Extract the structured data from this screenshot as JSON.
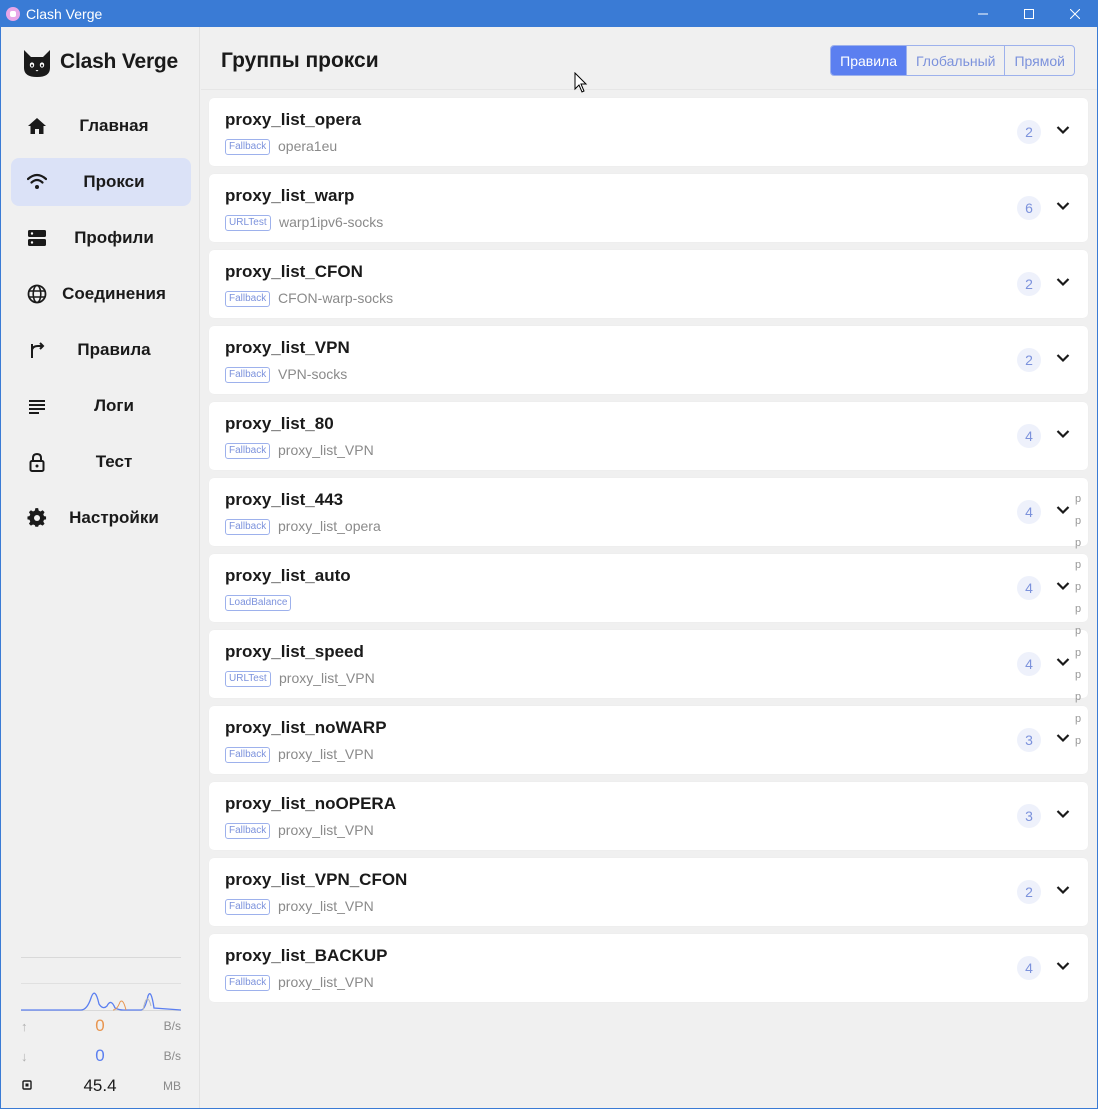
{
  "window": {
    "title": "Clash Verge",
    "minimize": "—",
    "maximize": "☐",
    "close": "✕"
  },
  "sidebar": {
    "logo_text": "Clash Verge",
    "items": [
      {
        "label": "Главная",
        "icon": "home-icon"
      },
      {
        "label": "Прокси",
        "icon": "wifi-icon",
        "active": true
      },
      {
        "label": "Профили",
        "icon": "server-icon"
      },
      {
        "label": "Соединения",
        "icon": "globe-icon"
      },
      {
        "label": "Правила",
        "icon": "fork-icon"
      },
      {
        "label": "Логи",
        "icon": "list-icon"
      },
      {
        "label": "Тест",
        "icon": "lock-icon"
      },
      {
        "label": "Настройки",
        "icon": "gear-icon"
      }
    ],
    "traffic": {
      "upload": {
        "value": "0",
        "unit": "B/s",
        "color": "#e8954f"
      },
      "download": {
        "value": "0",
        "unit": "B/s",
        "color": "#5b7ff0"
      },
      "memory": {
        "value": "45.4",
        "unit": "MB"
      }
    }
  },
  "header": {
    "title": "Группы прокси",
    "modes": [
      {
        "label": "Правила",
        "active": true
      },
      {
        "label": "Глобальный",
        "active": false
      },
      {
        "label": "Прямой",
        "active": false
      }
    ]
  },
  "groups": [
    {
      "name": "proxy_list_opera",
      "type": "Fallback",
      "now": "opera1eu",
      "count": "2"
    },
    {
      "name": "proxy_list_warp",
      "type": "URLTest",
      "now": "warp1ipv6-socks",
      "count": "6"
    },
    {
      "name": "proxy_list_CFON",
      "type": "Fallback",
      "now": "CFON-warp-socks",
      "count": "2"
    },
    {
      "name": "proxy_list_VPN",
      "type": "Fallback",
      "now": "VPN-socks",
      "count": "2"
    },
    {
      "name": "proxy_list_80",
      "type": "Fallback",
      "now": "proxy_list_VPN",
      "count": "4"
    },
    {
      "name": "proxy_list_443",
      "type": "Fallback",
      "now": "proxy_list_opera",
      "count": "4"
    },
    {
      "name": "proxy_list_auto",
      "type": "LoadBalance",
      "now": "",
      "count": "4"
    },
    {
      "name": "proxy_list_speed",
      "type": "URLTest",
      "now": "proxy_list_VPN",
      "count": "4"
    },
    {
      "name": "proxy_list_noWARP",
      "type": "Fallback",
      "now": "proxy_list_VPN",
      "count": "3"
    },
    {
      "name": "proxy_list_noOPERA",
      "type": "Fallback",
      "now": "proxy_list_VPN",
      "count": "3"
    },
    {
      "name": "proxy_list_VPN_CFON",
      "type": "Fallback",
      "now": "proxy_list_VPN",
      "count": "2"
    },
    {
      "name": "proxy_list_BACKUP",
      "type": "Fallback",
      "now": "proxy_list_VPN",
      "count": "4"
    }
  ],
  "letter_strip": [
    "p",
    "p",
    "p",
    "p",
    "p",
    "p",
    "p",
    "p",
    "p",
    "p",
    "p",
    "p"
  ],
  "colors": {
    "titlebar": "#3a7bd5",
    "accent": "#5b7ff0",
    "active_nav": "#dbe2f7"
  }
}
